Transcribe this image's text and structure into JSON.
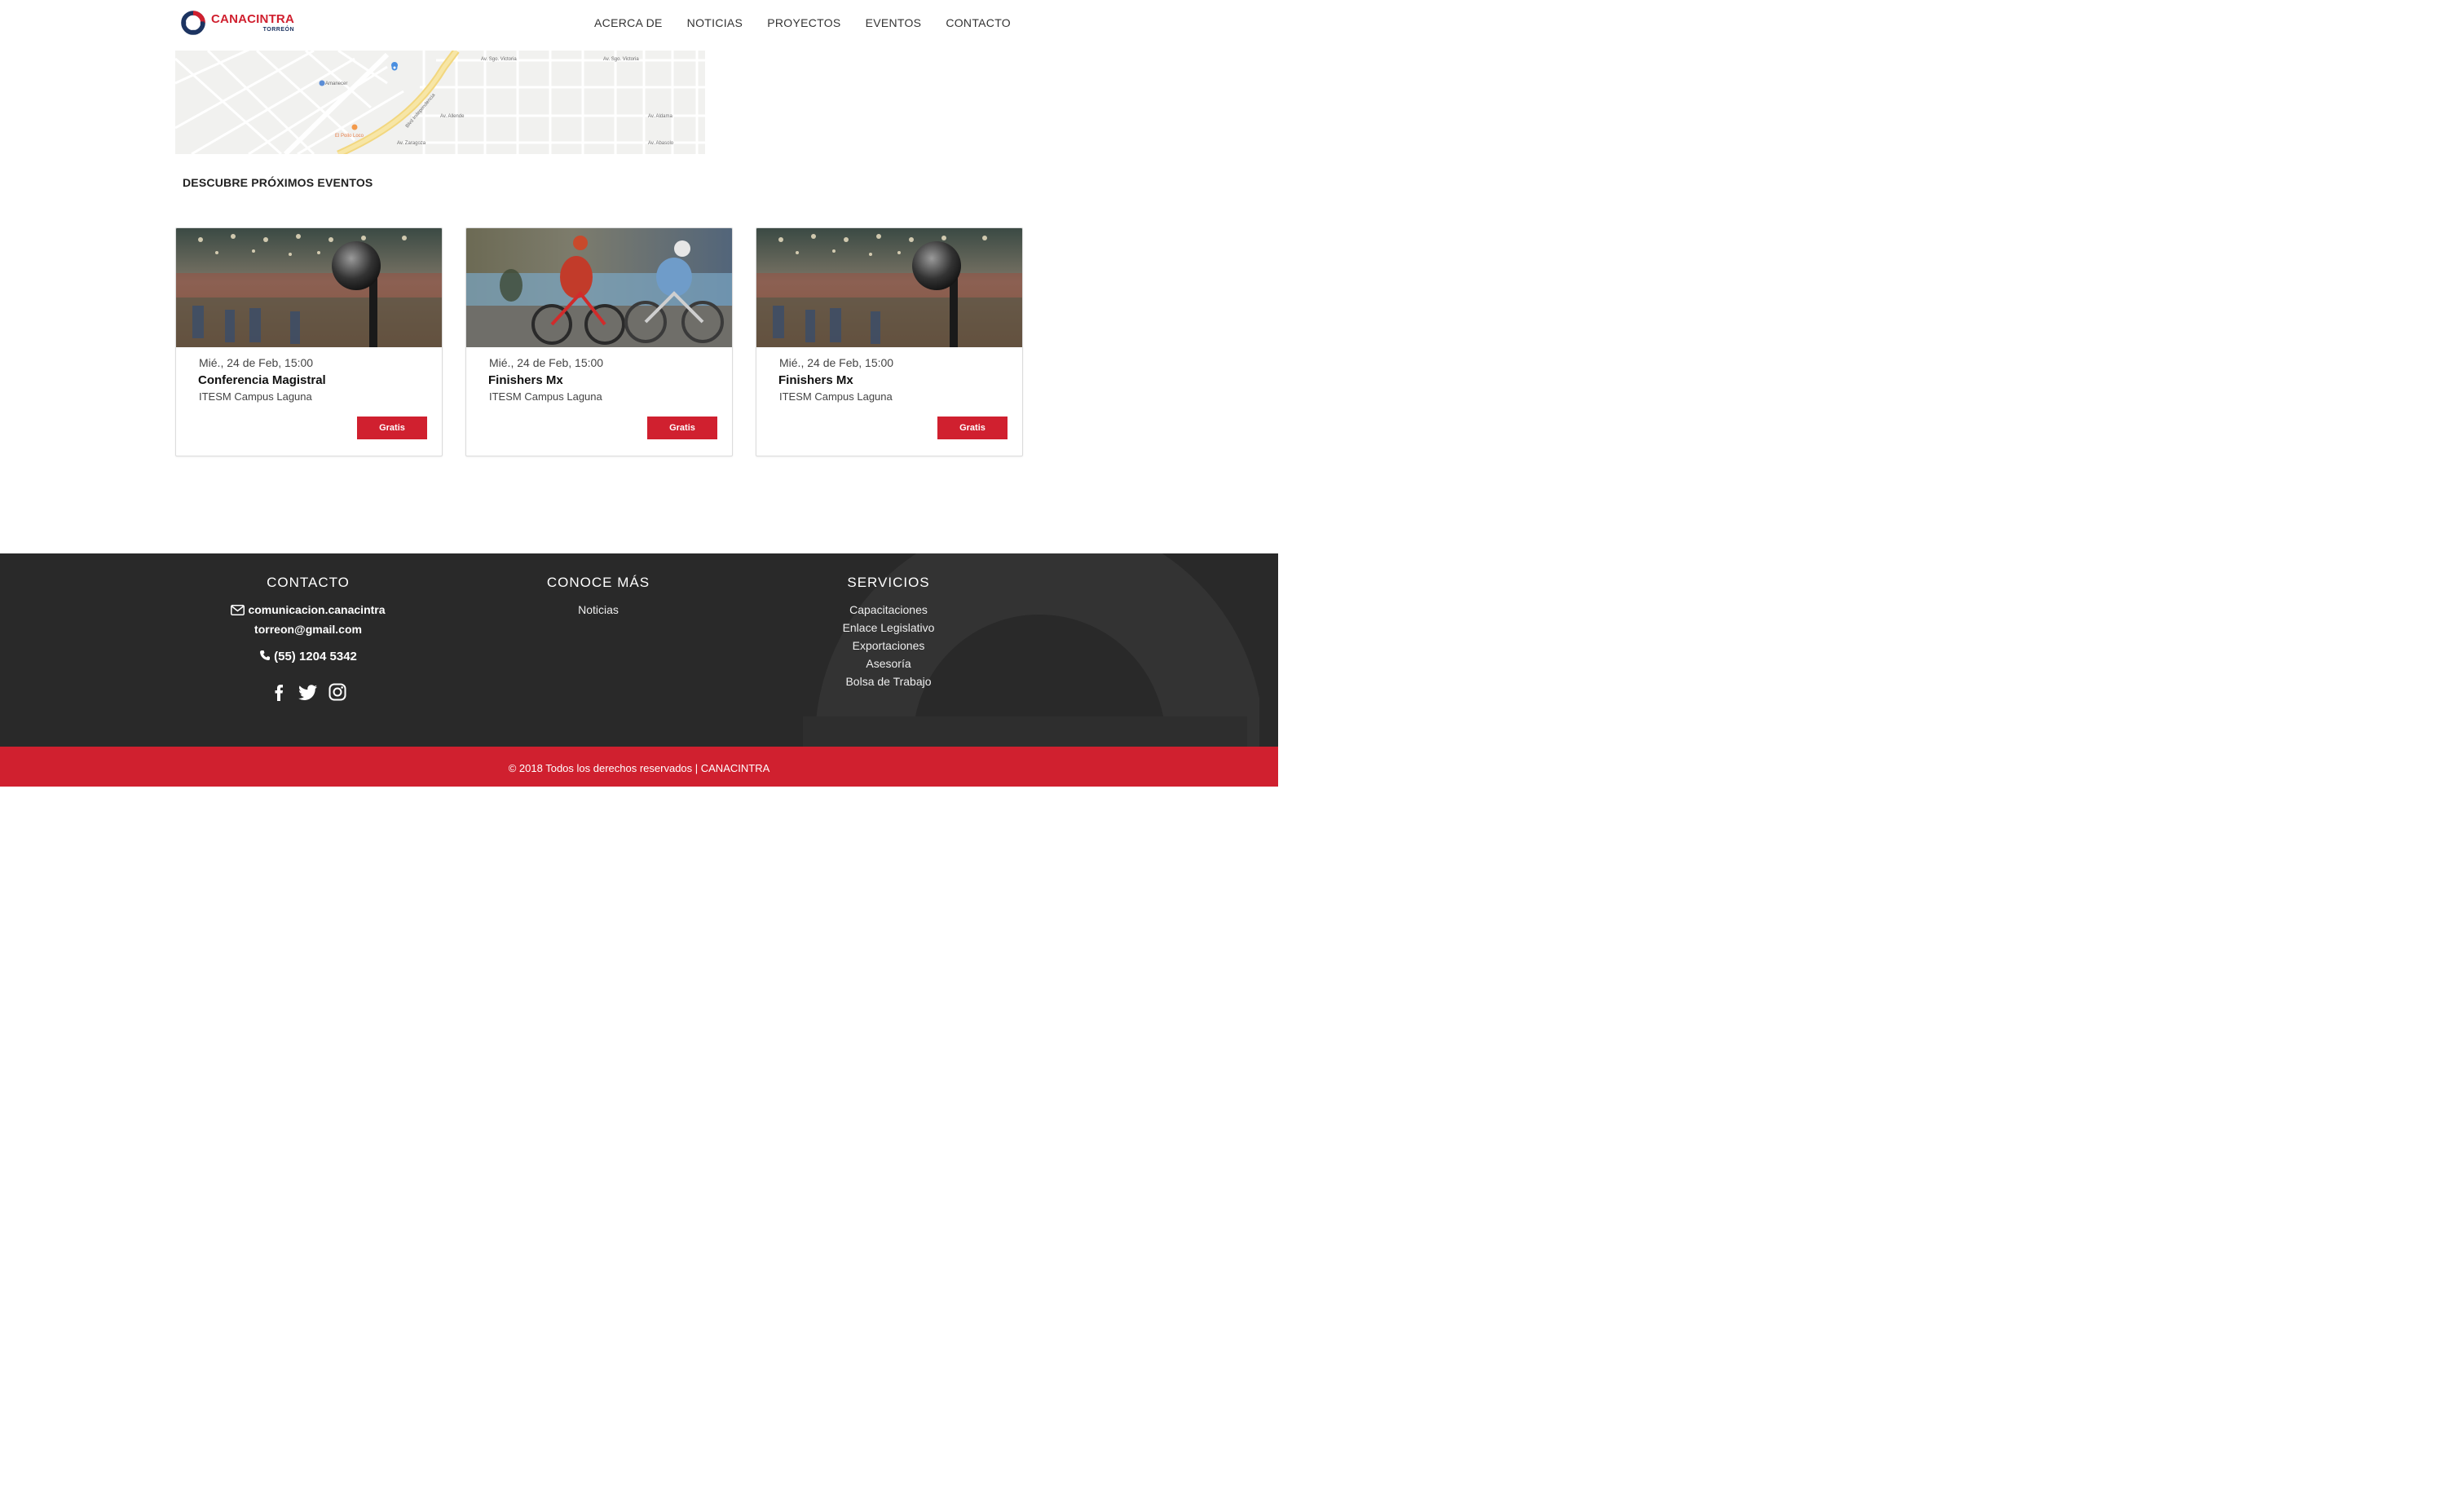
{
  "header": {
    "logo_name": "CANACINTRA",
    "logo_sub": "TORREÓN",
    "nav": [
      "ACERCA DE",
      "NOTICIAS",
      "PROYECTOS",
      "EVENTOS",
      "CONTACTO"
    ]
  },
  "map": {
    "labels": {
      "amanecer": "Amanecer",
      "pollo": "El Pollo Loco",
      "blvd": "Blvd Independencia",
      "sgo": "Av. Sgo. Victoria",
      "abasolo": "Av. Abasolo",
      "zaragoza": "Av. Zaragoza",
      "aldama": "Av. Aldama",
      "allende": "Av. Allende"
    }
  },
  "section": {
    "title": "DESCUBRE PRÓXIMOS EVENTOS"
  },
  "events": [
    {
      "date": "Mié., 24 de Feb, 15:00",
      "title": "Conferencia Magistral",
      "venue": "ITESM Campus Laguna",
      "price": "Gratis",
      "image": "conference-microphone"
    },
    {
      "date": "Mié., 24 de Feb, 15:00",
      "title": "Finishers Mx",
      "venue": "ITESM Campus Laguna",
      "price": "Gratis",
      "image": "cyclists"
    },
    {
      "date": "Mié., 24 de Feb, 15:00",
      "title": "Finishers Mx",
      "venue": "ITESM Campus Laguna",
      "price": "Gratis",
      "image": "conference-microphone"
    }
  ],
  "footer": {
    "contact": {
      "heading": "CONTACTO",
      "email_line1": "comunicacion.canacintra",
      "email_line2": "torreon@gmail.com",
      "phone": "(55) 1204 5342",
      "social": [
        "facebook-icon",
        "twitter-icon",
        "instagram-icon"
      ]
    },
    "more": {
      "heading": "CONOCE MÁS",
      "links": [
        "Noticias"
      ]
    },
    "services": {
      "heading": "SERVICIOS",
      "links": [
        "Capacitaciones",
        "Enlace Legislativo",
        "Exportaciones",
        "Asesoría",
        "Bolsa de Trabajo"
      ]
    }
  },
  "copyright": "© 2018 Todos los derechos reservados | CANACINTRA",
  "colors": {
    "brand_red": "#d0202f",
    "brand_navy": "#1d3461",
    "footer_bg": "#292929"
  }
}
